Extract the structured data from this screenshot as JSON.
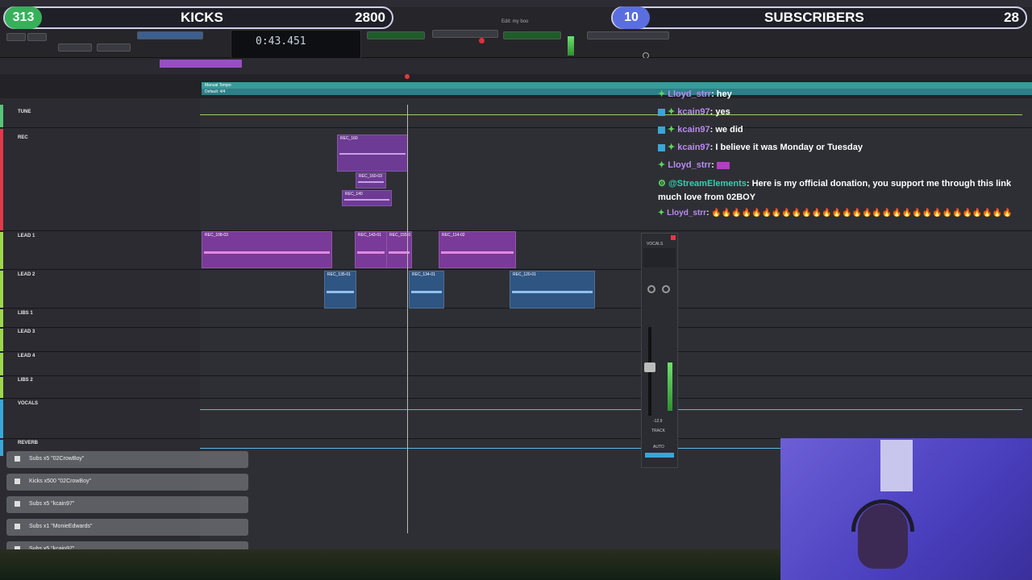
{
  "overlay": {
    "kicks": {
      "count": "313",
      "label": "KICKS",
      "goal": "2800"
    },
    "subscribers": {
      "count": "10",
      "label": "SUBSCRIBERS",
      "goal": "28"
    }
  },
  "window": {
    "title": "Edit: my boo"
  },
  "transport": {
    "counter": "0:43.451"
  },
  "ruler": {
    "tempo_label": "Manual Tempo",
    "meter_label": "Default: 4/4"
  },
  "tracks": [
    {
      "name": "TUNE",
      "color": "#58c37b"
    },
    {
      "name": "REC",
      "color": "#e0394a"
    },
    {
      "name": "LEAD 1",
      "color": "#9dd64a"
    },
    {
      "name": "LEAD 2",
      "color": "#9dd64a"
    },
    {
      "name": "LIBS 1",
      "color": "#9dd64a"
    },
    {
      "name": "LEAD 3",
      "color": "#9dd64a"
    },
    {
      "name": "LEAD 4",
      "color": "#9dd64a"
    },
    {
      "name": "LIBS 2",
      "color": "#9dd64a"
    },
    {
      "name": "VOCALS",
      "color": "#3aa6d8"
    },
    {
      "name": "REVERB",
      "color": "#3aa6d8"
    }
  ],
  "clips": [
    {
      "label": "REC_160",
      "color": "#8a48b8"
    },
    {
      "label": "REC_160-03",
      "color": "#8a48b8"
    },
    {
      "label": "REC_140",
      "color": "#8a48b8"
    },
    {
      "label": "REC_108-03",
      "color": "#a347b8"
    },
    {
      "label": "REC_143-01",
      "color": "#a347b8"
    },
    {
      "label": "REC_155-0",
      "color": "#a347b8"
    },
    {
      "label": "REC_114-02",
      "color": "#a347b8"
    },
    {
      "label": "REC_135-01",
      "color": "#3b6fa8"
    },
    {
      "label": "REC_134-01",
      "color": "#3b6fa8"
    },
    {
      "label": "REC_120-01",
      "color": "#3b6fa8"
    }
  ],
  "chat": [
    {
      "user": "Lloyd_strr",
      "text": ": hey"
    },
    {
      "user": "kcain97",
      "text": ": yes"
    },
    {
      "user": "kcain97",
      "text": ": we did"
    },
    {
      "user": "kcain97",
      "text": ": I believe it was Monday or Tuesday"
    },
    {
      "user": "Lloyd_strr",
      "text": ":"
    },
    {
      "user": "@StreamElements",
      "text": ": Here is my official donation, you support me through this link much love from 02BOY"
    },
    {
      "user": "Lloyd_strr",
      "text": ": 🔥🔥🔥🔥🔥🔥🔥🔥🔥🔥🔥🔥🔥🔥🔥🔥🔥🔥🔥🔥🔥🔥🔥🔥🔥🔥🔥🔥🔥🔥"
    }
  ],
  "mixer": {
    "track_name": "VOCALS",
    "fader_value": "-12.9",
    "track_label": "TRACK",
    "auto_label": "AUTO"
  },
  "alerts": [
    {
      "text": "Subs x5 \"02CrowBoy\""
    },
    {
      "text": "Kicks x500 \"02CrowBoy\""
    },
    {
      "text": "Subs x5 \"kcain97\""
    },
    {
      "text": "Subs x1 \"MonieEdwards\""
    },
    {
      "text": "Subs x5 \"kcain97\""
    }
  ],
  "colors": {
    "accent_green": "#36b15a",
    "chat_name": "#b98bf2",
    "stream_elements": "#2fd2b0"
  }
}
